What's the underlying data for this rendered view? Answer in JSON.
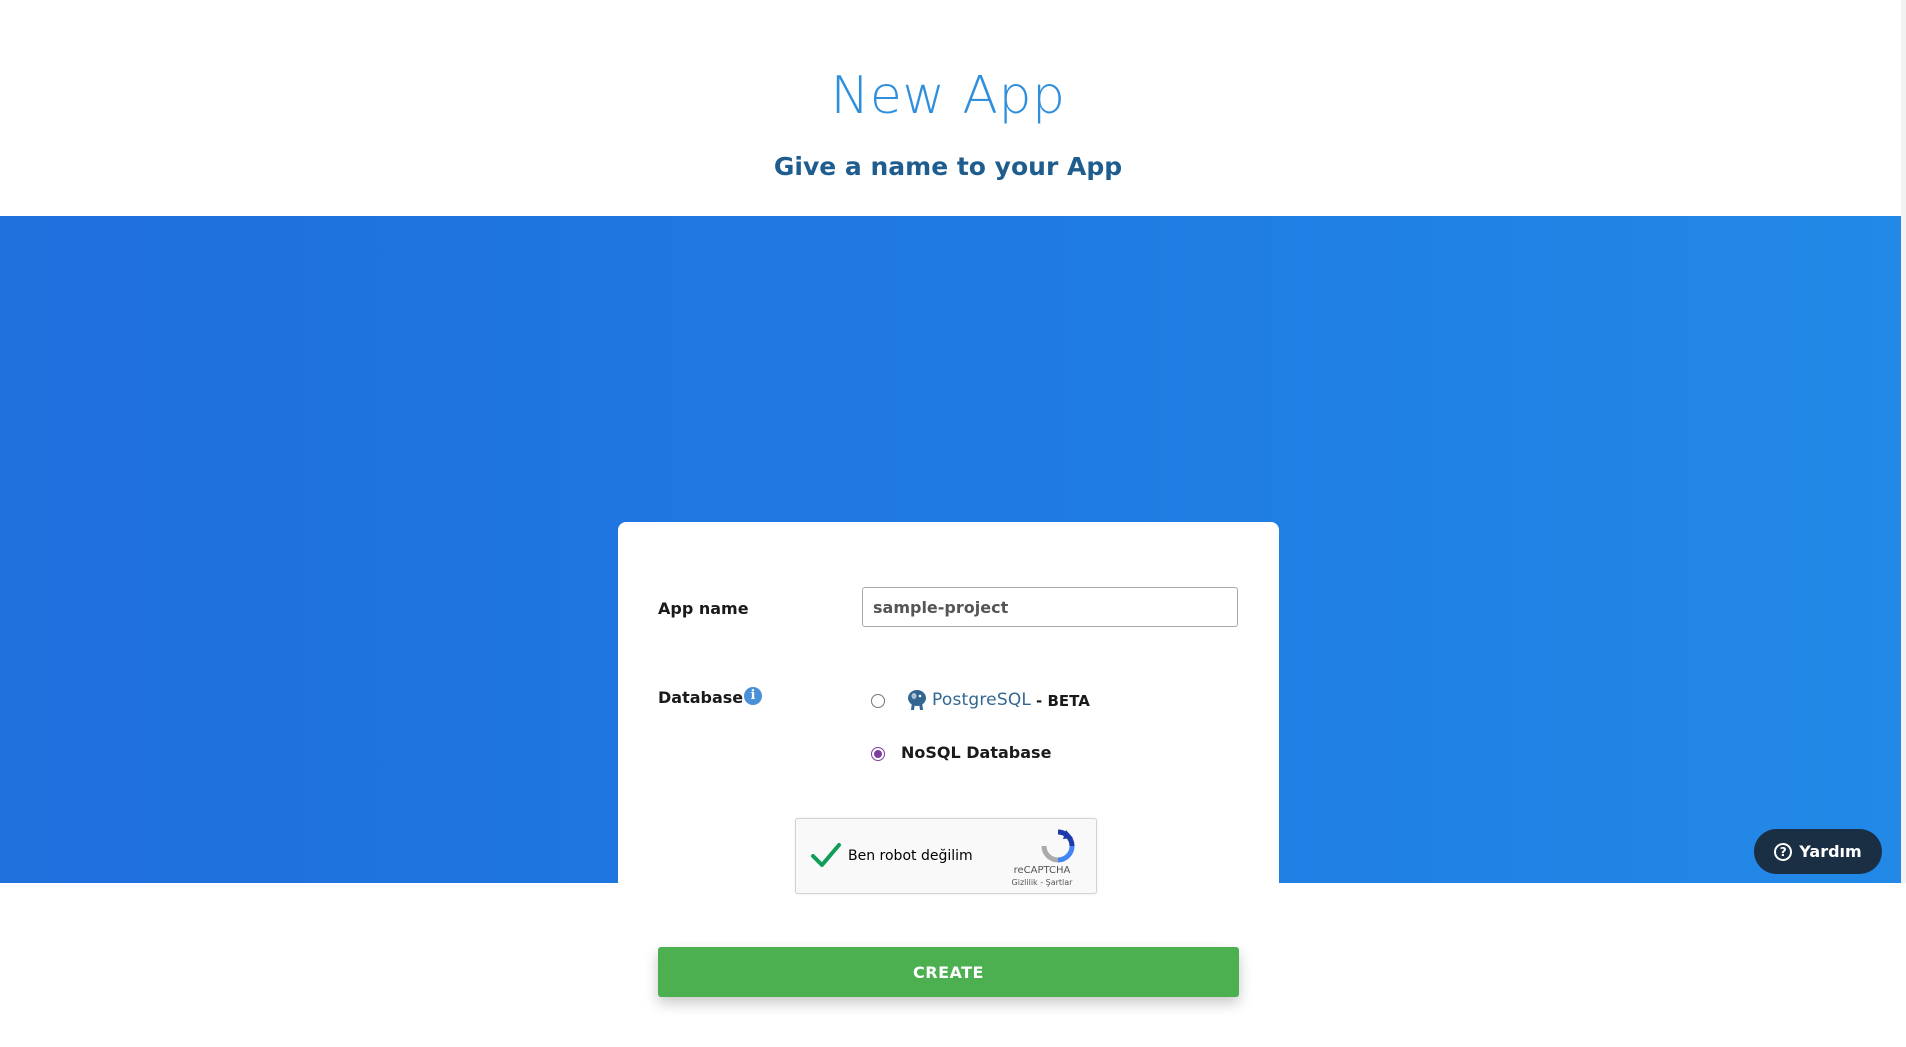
{
  "header": {
    "title": "New App",
    "subtitle": "Give a name to your App"
  },
  "form": {
    "app_name_label": "App name",
    "app_name_value": "sample-project",
    "database_label": "Database",
    "database_info_icon": "info-icon",
    "options": [
      {
        "id": "postgresql",
        "logo_text": "PostgreSQL",
        "suffix": "- BETA",
        "selected": false
      },
      {
        "id": "nosql",
        "label": "NoSQL Database",
        "selected": true
      }
    ],
    "captcha": {
      "label": "Ben robot değilim",
      "checked": true,
      "brand": "reCAPTCHA",
      "links": "Gizlilik - Şartlar"
    },
    "create_label": "CREATE"
  },
  "help": {
    "label": "Yardım",
    "icon": "question-circle-icon"
  },
  "colors": {
    "accent_blue": "#2f8fdc",
    "subtitle_blue": "#1f5d8f",
    "hero_blue": "#1f7be2",
    "create_green": "#4caf50",
    "help_dark": "#1a2e44",
    "radio_purple": "#7b3fa0"
  }
}
